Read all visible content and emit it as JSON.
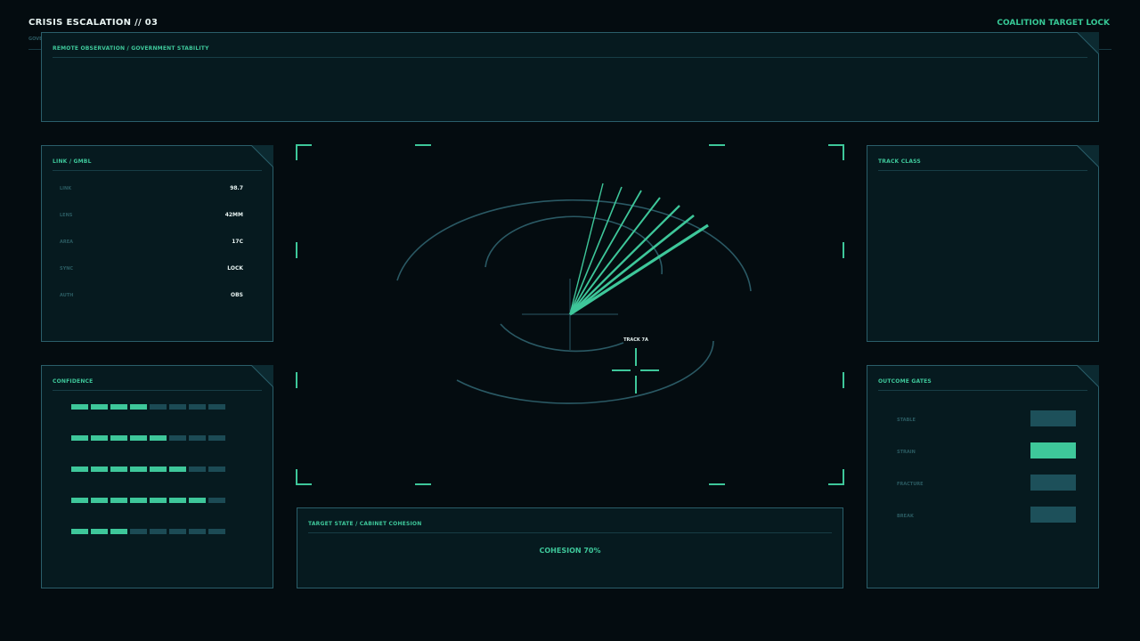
{
  "header": {
    "title": "CRISIS ESCALATION // 03",
    "subtitle": "GOVE",
    "right_label": "COALITION TARGET LOCK"
  },
  "observation": {
    "title": "REMOTE OBSERVATION / GOVERNMENT STABILITY"
  },
  "link_panel": {
    "title": "LINK / GMBL",
    "rows": [
      {
        "label": "LINK",
        "value": "98.7"
      },
      {
        "label": "LENS",
        "value": "42MM"
      },
      {
        "label": "AREA",
        "value": "17C"
      },
      {
        "label": "SYNC",
        "value": "LOCK"
      },
      {
        "label": "AUTH",
        "value": "OBS"
      }
    ]
  },
  "confidence": {
    "title": "CONFIDENCE",
    "segments_total": 8,
    "levels": [
      4,
      5,
      6,
      7,
      3
    ]
  },
  "radar": {
    "track_label": "TRACK 7A"
  },
  "track_class": {
    "title": "TRACK CLASS"
  },
  "outcome_gates": {
    "title": "OUTCOME GATES",
    "gates": [
      {
        "label": "STABLE",
        "active": false
      },
      {
        "label": "STRAIN",
        "active": true
      },
      {
        "label": "FRACTURE",
        "active": false
      },
      {
        "label": "BREAK",
        "active": false
      }
    ]
  },
  "target_state": {
    "title": "TARGET STATE / CABINET COHESION",
    "cohesion": "COHESION 70%"
  },
  "colors": {
    "accent": "#3ec79a",
    "panel_bg": "#061a1f",
    "border": "#2a5e6a",
    "background": "#040c10"
  }
}
